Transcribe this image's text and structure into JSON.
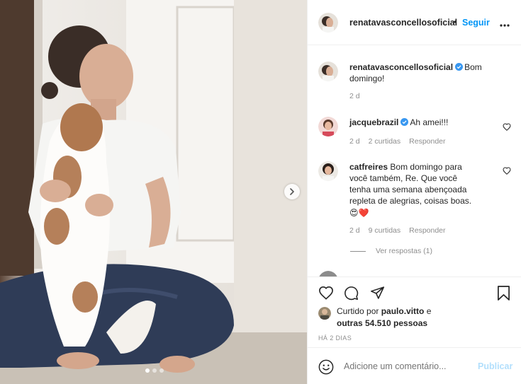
{
  "post": {
    "author": "renatavasconcellosoficial",
    "author_truncated": "l",
    "separator": "•",
    "follow_label": "Seguir",
    "more_icon": "more-horizontal-icon",
    "carousel": {
      "slides": 3,
      "active_index": 0,
      "next_icon": "chevron-right-icon"
    }
  },
  "caption": {
    "username": "renatavasconcellosoficial",
    "verified": true,
    "text": "Bom domingo!",
    "time": "2 d"
  },
  "comments": [
    {
      "username": "jacquebrazil",
      "verified": true,
      "text": "Ah amei!!!",
      "time": "2 d",
      "likes_label": "2 curtidas",
      "reply_label": "Responder"
    },
    {
      "username": "catfreires",
      "verified": false,
      "text": "Bom domingo para você também, Re. Que você tenha uma semana abençoada repleta de alegrias, coisas boas.",
      "emoji": "😍❤️",
      "time": "2 d",
      "likes_label": "9 curtidas",
      "reply_label": "Responder"
    }
  ],
  "view_replies_label": "Ver respostas (1)",
  "likes": {
    "prefix": "Curtido por",
    "user": "paulo.vitto",
    "connector": "e",
    "others": "outras 54.510 pessoas"
  },
  "date_label": "HÁ 2 DIAS",
  "composer": {
    "placeholder": "Adicione um comentário...",
    "post_label": "Publicar"
  },
  "colors": {
    "accent": "#0095f6",
    "accent_disabled": "#b2dffc",
    "verified": "#3897f0",
    "secondary_text": "#8e8e8e",
    "border": "#efefef"
  }
}
